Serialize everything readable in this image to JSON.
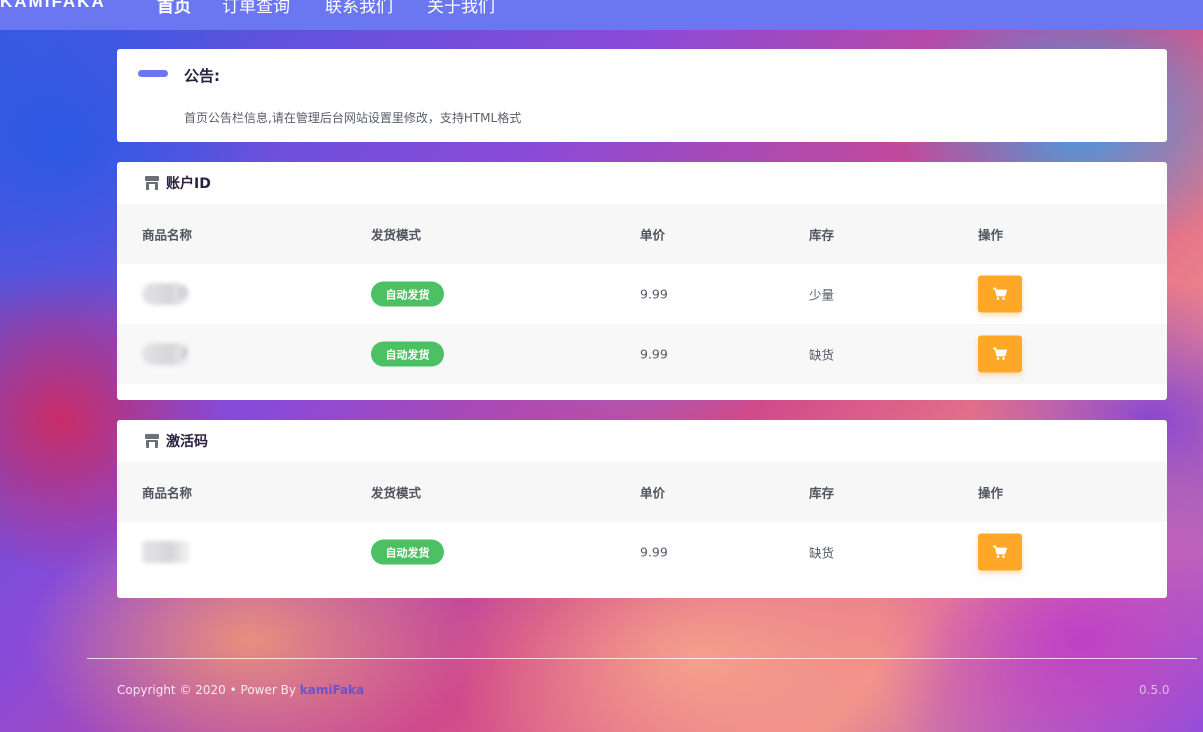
{
  "nav": {
    "brand": "KAMIFAKA",
    "items": [
      "首页",
      "订单查询",
      "联系我们",
      "关于我们"
    ]
  },
  "notice": {
    "title": "公告:",
    "text": "首页公告栏信息,请在管理后台网站设置里修改，支持HTML格式"
  },
  "table_headers": [
    "商品名称",
    "发货模式",
    "单价",
    "库存",
    "操作"
  ],
  "categories": [
    {
      "title": "账户ID",
      "products": [
        {
          "name_visible": "D",
          "mode": "自动发货",
          "price": "9.99",
          "stock": "少量"
        },
        {
          "name_visible": "2",
          "mode": "自动发货",
          "price": "9.99",
          "stock": "缺货"
        }
      ]
    },
    {
      "title": "激活码",
      "products": [
        {
          "name_visible": "",
          "mode": "自动发货",
          "price": "9.99",
          "stock": "缺货"
        }
      ]
    }
  ],
  "footer": {
    "copyright": "Copyright © 2020  •  Power By ",
    "brand": "kamiFaka",
    "version": "0.5.0"
  },
  "colors": {
    "nav": "#6a77f0",
    "badge": "#4cc163",
    "cart_button": "#ffa726"
  },
  "icons": [
    "store-icon",
    "cart-icon"
  ]
}
